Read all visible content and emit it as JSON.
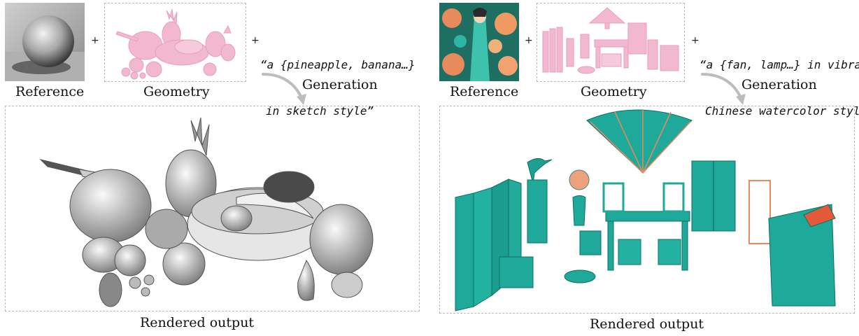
{
  "left_panel": {
    "reference_label": "Reference",
    "geometry_label": "Geometry",
    "prompt_line1": "“a {pineapple, banana…}",
    "prompt_line2": "in sketch style”",
    "generation_label": "Generation",
    "output_caption": "Rendered output"
  },
  "right_panel": {
    "reference_label": "Reference",
    "geometry_label": "Geometry",
    "prompt_line1": "“a {fan, lamp…} in vibrant",
    "prompt_line2": "Chinese watercolor style”",
    "generation_label": "Generation",
    "output_caption": "Rendered output"
  },
  "plus_symbol": "+",
  "colors": {
    "geometry_pink": "#f2b8cf",
    "jade_teal": "#1fa99a",
    "sketch_gray": "#9a9a9a",
    "coral": "#e98a5c",
    "dashed_border": "#b8b8b8"
  }
}
